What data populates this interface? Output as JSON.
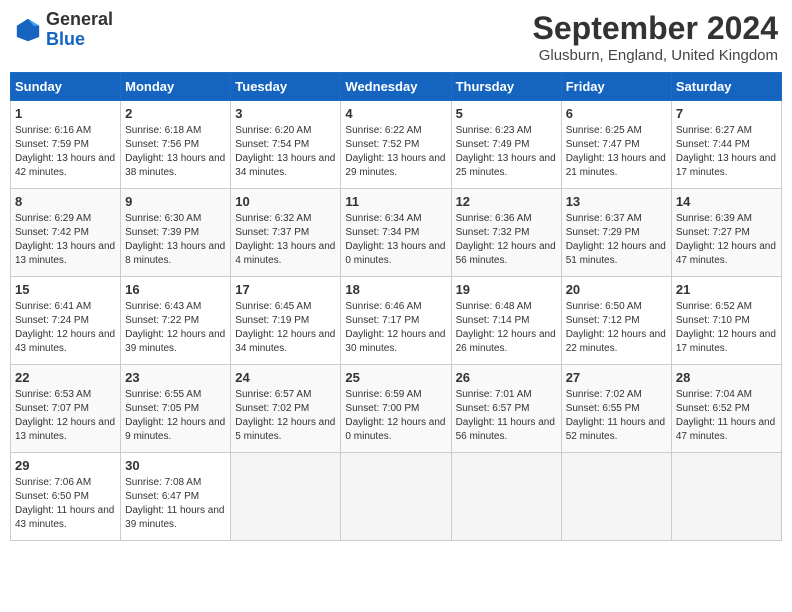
{
  "header": {
    "logo_general": "General",
    "logo_blue": "Blue",
    "month_year": "September 2024",
    "location": "Glusburn, England, United Kingdom"
  },
  "calendar": {
    "days": [
      "Sunday",
      "Monday",
      "Tuesday",
      "Wednesday",
      "Thursday",
      "Friday",
      "Saturday"
    ],
    "weeks": [
      [
        {
          "day": "1",
          "sunrise": "6:16 AM",
          "sunset": "7:59 PM",
          "daylight": "13 hours and 42 minutes."
        },
        {
          "day": "2",
          "sunrise": "6:18 AM",
          "sunset": "7:56 PM",
          "daylight": "13 hours and 38 minutes."
        },
        {
          "day": "3",
          "sunrise": "6:20 AM",
          "sunset": "7:54 PM",
          "daylight": "13 hours and 34 minutes."
        },
        {
          "day": "4",
          "sunrise": "6:22 AM",
          "sunset": "7:52 PM",
          "daylight": "13 hours and 29 minutes."
        },
        {
          "day": "5",
          "sunrise": "6:23 AM",
          "sunset": "7:49 PM",
          "daylight": "13 hours and 25 minutes."
        },
        {
          "day": "6",
          "sunrise": "6:25 AM",
          "sunset": "7:47 PM",
          "daylight": "13 hours and 21 minutes."
        },
        {
          "day": "7",
          "sunrise": "6:27 AM",
          "sunset": "7:44 PM",
          "daylight": "13 hours and 17 minutes."
        }
      ],
      [
        {
          "day": "8",
          "sunrise": "6:29 AM",
          "sunset": "7:42 PM",
          "daylight": "13 hours and 13 minutes."
        },
        {
          "day": "9",
          "sunrise": "6:30 AM",
          "sunset": "7:39 PM",
          "daylight": "13 hours and 8 minutes."
        },
        {
          "day": "10",
          "sunrise": "6:32 AM",
          "sunset": "7:37 PM",
          "daylight": "13 hours and 4 minutes."
        },
        {
          "day": "11",
          "sunrise": "6:34 AM",
          "sunset": "7:34 PM",
          "daylight": "13 hours and 0 minutes."
        },
        {
          "day": "12",
          "sunrise": "6:36 AM",
          "sunset": "7:32 PM",
          "daylight": "12 hours and 56 minutes."
        },
        {
          "day": "13",
          "sunrise": "6:37 AM",
          "sunset": "7:29 PM",
          "daylight": "12 hours and 51 minutes."
        },
        {
          "day": "14",
          "sunrise": "6:39 AM",
          "sunset": "7:27 PM",
          "daylight": "12 hours and 47 minutes."
        }
      ],
      [
        {
          "day": "15",
          "sunrise": "6:41 AM",
          "sunset": "7:24 PM",
          "daylight": "12 hours and 43 minutes."
        },
        {
          "day": "16",
          "sunrise": "6:43 AM",
          "sunset": "7:22 PM",
          "daylight": "12 hours and 39 minutes."
        },
        {
          "day": "17",
          "sunrise": "6:45 AM",
          "sunset": "7:19 PM",
          "daylight": "12 hours and 34 minutes."
        },
        {
          "day": "18",
          "sunrise": "6:46 AM",
          "sunset": "7:17 PM",
          "daylight": "12 hours and 30 minutes."
        },
        {
          "day": "19",
          "sunrise": "6:48 AM",
          "sunset": "7:14 PM",
          "daylight": "12 hours and 26 minutes."
        },
        {
          "day": "20",
          "sunrise": "6:50 AM",
          "sunset": "7:12 PM",
          "daylight": "12 hours and 22 minutes."
        },
        {
          "day": "21",
          "sunrise": "6:52 AM",
          "sunset": "7:10 PM",
          "daylight": "12 hours and 17 minutes."
        }
      ],
      [
        {
          "day": "22",
          "sunrise": "6:53 AM",
          "sunset": "7:07 PM",
          "daylight": "12 hours and 13 minutes."
        },
        {
          "day": "23",
          "sunrise": "6:55 AM",
          "sunset": "7:05 PM",
          "daylight": "12 hours and 9 minutes."
        },
        {
          "day": "24",
          "sunrise": "6:57 AM",
          "sunset": "7:02 PM",
          "daylight": "12 hours and 5 minutes."
        },
        {
          "day": "25",
          "sunrise": "6:59 AM",
          "sunset": "7:00 PM",
          "daylight": "12 hours and 0 minutes."
        },
        {
          "day": "26",
          "sunrise": "7:01 AM",
          "sunset": "6:57 PM",
          "daylight": "11 hours and 56 minutes."
        },
        {
          "day": "27",
          "sunrise": "7:02 AM",
          "sunset": "6:55 PM",
          "daylight": "11 hours and 52 minutes."
        },
        {
          "day": "28",
          "sunrise": "7:04 AM",
          "sunset": "6:52 PM",
          "daylight": "11 hours and 47 minutes."
        }
      ],
      [
        {
          "day": "29",
          "sunrise": "7:06 AM",
          "sunset": "6:50 PM",
          "daylight": "11 hours and 43 minutes."
        },
        {
          "day": "30",
          "sunrise": "7:08 AM",
          "sunset": "6:47 PM",
          "daylight": "11 hours and 39 minutes."
        },
        {
          "day": "",
          "sunrise": "",
          "sunset": "",
          "daylight": ""
        },
        {
          "day": "",
          "sunrise": "",
          "sunset": "",
          "daylight": ""
        },
        {
          "day": "",
          "sunrise": "",
          "sunset": "",
          "daylight": ""
        },
        {
          "day": "",
          "sunrise": "",
          "sunset": "",
          "daylight": ""
        },
        {
          "day": "",
          "sunrise": "",
          "sunset": "",
          "daylight": ""
        }
      ]
    ]
  }
}
